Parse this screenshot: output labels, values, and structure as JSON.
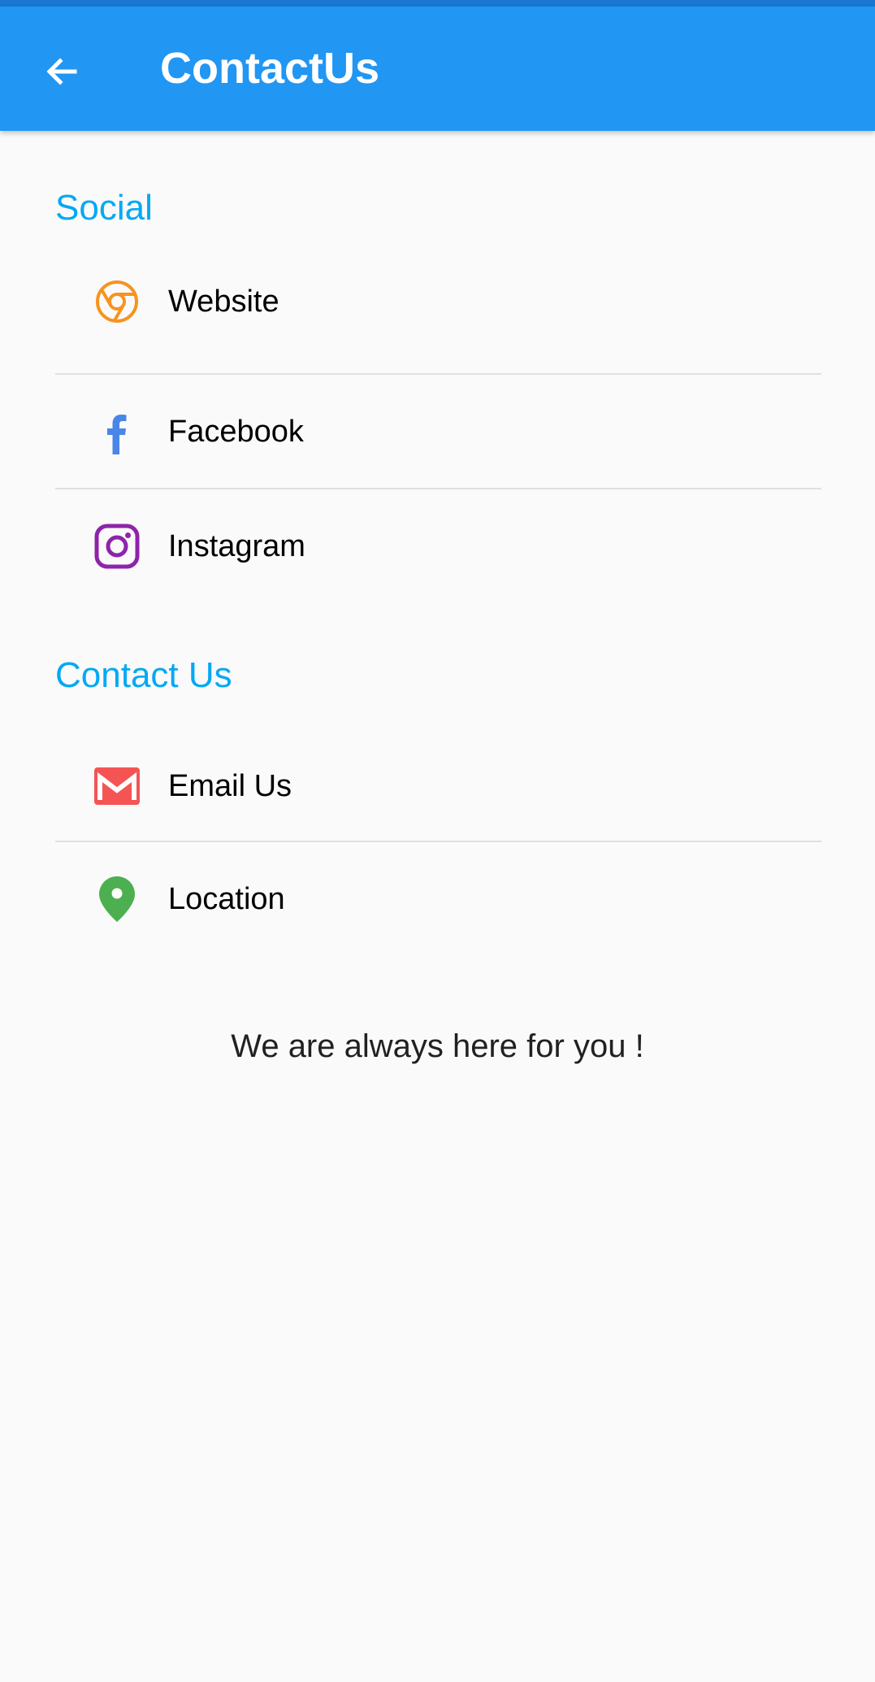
{
  "app_bar": {
    "title": "ContactUs",
    "background": "#2196f3",
    "back_icon": "arrow-left-icon"
  },
  "sections": {
    "social": {
      "title": "Social",
      "items": [
        {
          "label": "Website",
          "icon": "chrome-icon",
          "color": "#f7931e"
        },
        {
          "label": "Facebook",
          "icon": "facebook-icon",
          "color": "#4a86e8"
        },
        {
          "label": "Instagram",
          "icon": "instagram-icon",
          "color": "#8e24aa"
        }
      ]
    },
    "contact": {
      "title": "Contact Us",
      "items": [
        {
          "label": "Email Us",
          "icon": "gmail-icon",
          "color": "#f55454"
        },
        {
          "label": "Location",
          "icon": "location-pin-icon",
          "color": "#4caf50"
        }
      ]
    }
  },
  "footer": {
    "text": "We are always here for you !"
  },
  "colors": {
    "accent": "#03a9f4",
    "status_bar": "#1976d2",
    "background": "#fafafa"
  }
}
